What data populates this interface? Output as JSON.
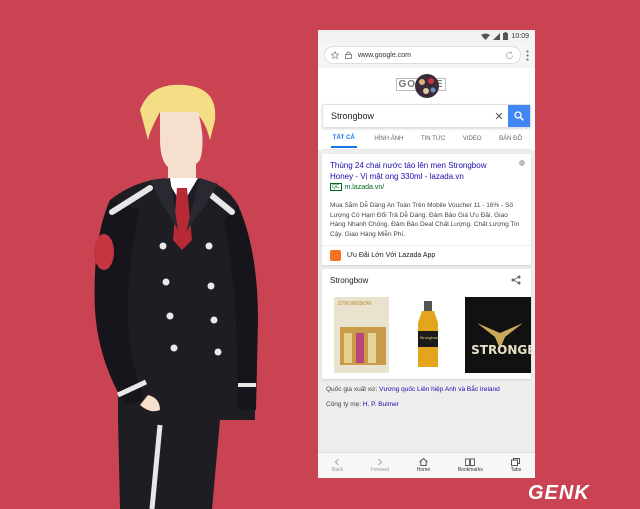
{
  "status_bar": {
    "time": "10:09"
  },
  "browser": {
    "url": "www.google.com"
  },
  "doodle": {
    "text": "GO  GLE"
  },
  "search": {
    "query": "Strongbow"
  },
  "tabs": [
    {
      "label": "TẤT CẢ",
      "active": true
    },
    {
      "label": "HÌNH ẢNH"
    },
    {
      "label": "TIN TỨC"
    },
    {
      "label": "VIDEO"
    },
    {
      "label": "BẢN ĐỒ"
    }
  ],
  "ad": {
    "title": "Thùng 24 chai nước táo lên men Strongbow Honey - Vị mật ong 330ml - lazada.vn",
    "badge": "QC",
    "url": "m.lazada.vn/",
    "description": "Mua Sắm Dễ Dàng An Toàn Trên Mobile Voucher 11 - 16% - Số Lượng Có Hạn! Đổi Trả Dễ Dàng. Đảm Bảo Giá Ưu Đãi. Giao Hàng Nhanh Chóng. Đảm Bảo Deal Chất Lượng. Chất Lượng Tin Cậy. Giao Hàng Miễn Phí.",
    "sitelink": "Ưu Đãi Lớn Với Lazada App"
  },
  "knowledge": {
    "title": "Strongbow",
    "images": [
      "STRONGBOW",
      "Strongbow",
      "STRONGB"
    ],
    "facts": {
      "origin_label": "Quốc gia xuất xứ:",
      "origin_value": "Vương quốc Liên hiệp Anh và Bắc Ireland",
      "company_label": "Công ty mẹ:",
      "company_value": "H. P. Bulmer"
    }
  },
  "bottom_nav": [
    {
      "label": "Back",
      "icon": "back-icon"
    },
    {
      "label": "Forward",
      "icon": "forward-icon"
    },
    {
      "label": "Home",
      "icon": "home-icon"
    },
    {
      "label": "Bookmarks",
      "icon": "bookmarks-icon"
    },
    {
      "label": "Tabs",
      "icon": "tabs-icon"
    }
  ],
  "watermark": "GENK",
  "colors": {
    "background": "#c94352",
    "link": "#1a0dab",
    "accent": "#4285f4"
  }
}
